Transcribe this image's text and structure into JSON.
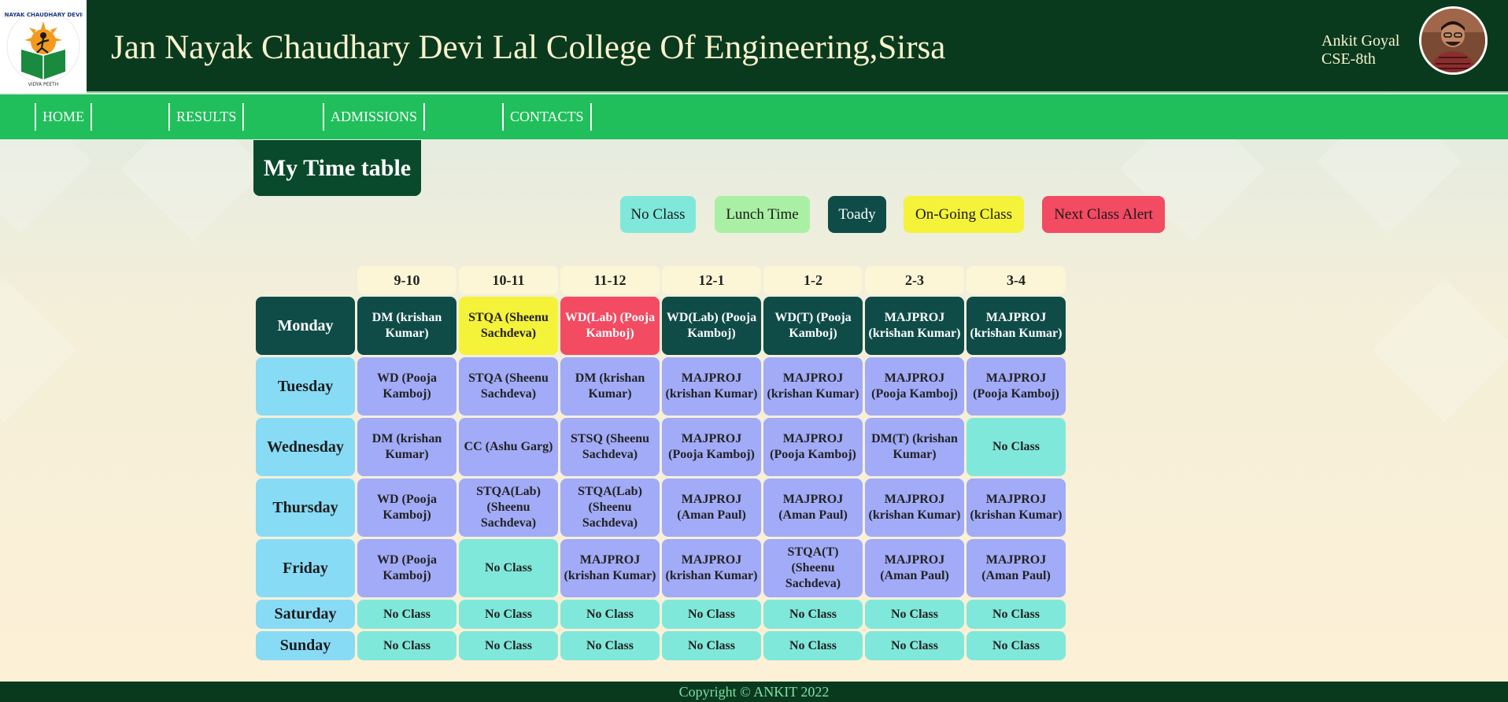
{
  "header": {
    "college_title": "Jan Nayak Chaudhary Devi Lal College Of Engineering,Sirsa",
    "user_name": "Ankit Goyal",
    "user_class": "CSE-8th"
  },
  "nav": {
    "items": [
      {
        "label": "HOME"
      },
      {
        "label": "RESULTS"
      },
      {
        "label": "ADMISSIONS"
      },
      {
        "label": "CONTACTS"
      }
    ]
  },
  "page_title": "My Time table",
  "legend": [
    {
      "label": "No Class",
      "color": "#80e8da"
    },
    {
      "label": "Lunch Time",
      "color": "#a9f0a4"
    },
    {
      "label": "Toady",
      "color": "#0f4c48"
    },
    {
      "label": "On-Going Class",
      "color": "#f5f23a"
    },
    {
      "label": "Next Class Alert",
      "color": "#f24b62"
    }
  ],
  "timetable": {
    "times": [
      "9-10",
      "10-11",
      "11-12",
      "12-1",
      "1-2",
      "2-3",
      "3-4"
    ],
    "days": [
      {
        "day": "Monday",
        "slots": [
          "DM (krishan Kumar)",
          "STQA (Sheenu Sachdeva)",
          "WD(Lab) (Pooja Kamboj)",
          "WD(Lab) (Pooja Kamboj)",
          "WD(T) (Pooja Kamboj)",
          "MAJPROJ (krishan Kumar)",
          "MAJPROJ (krishan Kumar)"
        ]
      },
      {
        "day": "Tuesday",
        "slots": [
          "WD (Pooja Kamboj)",
          "STQA (Sheenu Sachdeva)",
          "DM (krishan Kumar)",
          "MAJPROJ (krishan Kumar)",
          "MAJPROJ (krishan Kumar)",
          "MAJPROJ (Pooja Kamboj)",
          "MAJPROJ (Pooja Kamboj)"
        ]
      },
      {
        "day": "Wednesday",
        "slots": [
          "DM (krishan Kumar)",
          "CC (Ashu Garg)",
          "STSQ (Sheenu Sachdeva)",
          "MAJPROJ (Pooja Kamboj)",
          "MAJPROJ (Pooja Kamboj)",
          "DM(T) (krishan Kumar)",
          "No Class"
        ]
      },
      {
        "day": "Thursday",
        "slots": [
          "WD (Pooja Kamboj)",
          "STQA(Lab) (Sheenu Sachdeva)",
          "STQA(Lab) (Sheenu Sachdeva)",
          "MAJPROJ (Aman Paul)",
          "MAJPROJ (Aman Paul)",
          "MAJPROJ (krishan Kumar)",
          "MAJPROJ (krishan Kumar)"
        ]
      },
      {
        "day": "Friday",
        "slots": [
          "WD (Pooja Kamboj)",
          "No Class",
          "MAJPROJ (krishan Kumar)",
          "MAJPROJ (krishan Kumar)",
          "STQA(T) (Sheenu Sachdeva)",
          "MAJPROJ (Aman Paul)",
          "MAJPROJ (Aman Paul)"
        ]
      },
      {
        "day": "Saturday",
        "slots": [
          "No Class",
          "No Class",
          "No Class",
          "No Class",
          "No Class",
          "No Class",
          "No Class"
        ]
      },
      {
        "day": "Sunday",
        "slots": [
          "No Class",
          "No Class",
          "No Class",
          "No Class",
          "No Class",
          "No Class",
          "No Class"
        ]
      }
    ]
  },
  "footer": {
    "copyright": "Copyright © ANKIT 2022"
  }
}
